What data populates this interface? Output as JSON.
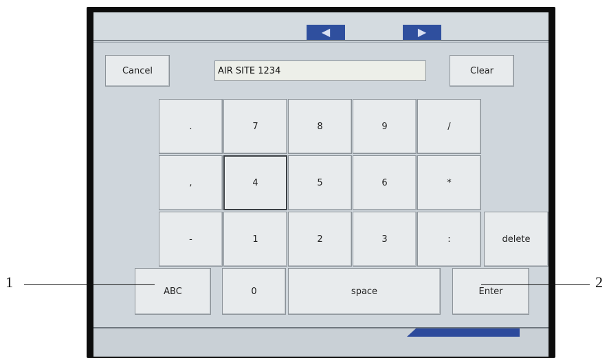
{
  "colors": {
    "screen_bg": "#cfd6dc",
    "key_face": "#e8ebed",
    "key_border": "#8b9298",
    "nav_blue": "#2f4f9e",
    "bezel": "#0c0c0c"
  },
  "header": {
    "nav_prev_icon": "left-arrow",
    "nav_next_icon": "right-arrow",
    "nav_prev_glyph": "◀",
    "nav_next_glyph": "▶"
  },
  "toolbar": {
    "cancel_label": "Cancel",
    "clear_label": "Clear"
  },
  "input": {
    "value": "AIR SITE 1234"
  },
  "keypad": {
    "row1": [
      ".",
      "7",
      "8",
      "9",
      "/"
    ],
    "row2": [
      ",",
      "4",
      "5",
      "6",
      "*"
    ],
    "row3": [
      "-",
      "1",
      "2",
      "3",
      ":"
    ],
    "delete_label": "delete",
    "abc_label": "ABC",
    "zero_label": "0",
    "space_label": "space",
    "enter_label": "Enter"
  },
  "callouts": {
    "left": "1",
    "right": "2"
  }
}
